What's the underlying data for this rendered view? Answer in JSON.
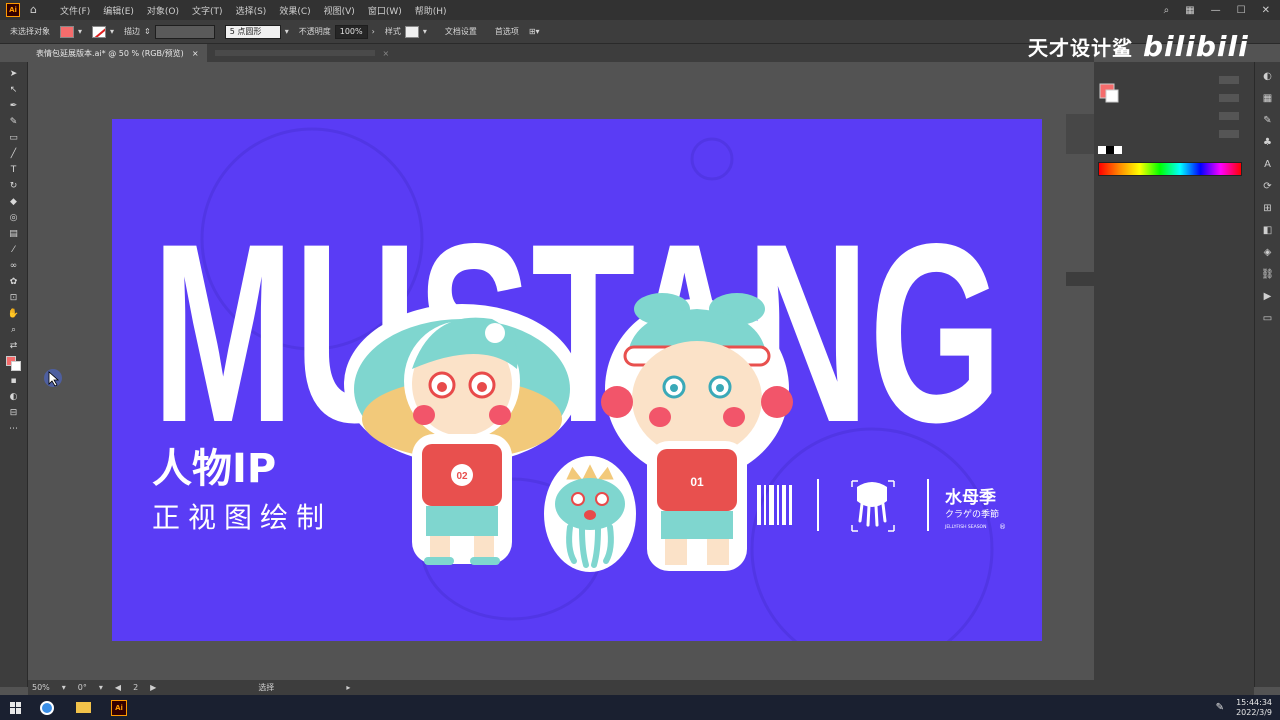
{
  "app": {
    "logo_text": "Ai",
    "menus": [
      "文件(F)",
      "编辑(E)",
      "对象(O)",
      "文字(T)",
      "选择(S)",
      "效果(C)",
      "视图(V)",
      "窗口(W)",
      "帮助(H)"
    ]
  },
  "controlbar": {
    "selection_label": "未选择对象",
    "stroke_label": "描边",
    "stroke_style": "5 点圆形",
    "opacity_label": "不透明度",
    "opacity_value": "100%",
    "style_label": "样式",
    "doc_setup": "文档设置",
    "preferences": "首选项"
  },
  "tabs": {
    "active_tab": "表情包延展版本.ai* @ 50 % (RGB/预览)",
    "close_icon": "×"
  },
  "artboard": {
    "headline": "MUSTANG",
    "title_cn": "人物IP",
    "subtitle_cn": "正视图绘制",
    "jersey_left": "02",
    "jersey_right": "01",
    "brand_name": "水母季",
    "brand_sub": "クラゲの季節",
    "brand_en": "JELLYFISH SEASON",
    "brand_mark": "®",
    "bg_color": "#5a3cf5"
  },
  "watermark": {
    "channel": "天才设计鲨",
    "site": "bilibili"
  },
  "status": {
    "zoom": "50%",
    "rotation": "0°",
    "artboard_nav": "2",
    "tool_name": "选择"
  },
  "taskbar": {
    "time": "15:44:34",
    "date": "2022/3/9"
  }
}
